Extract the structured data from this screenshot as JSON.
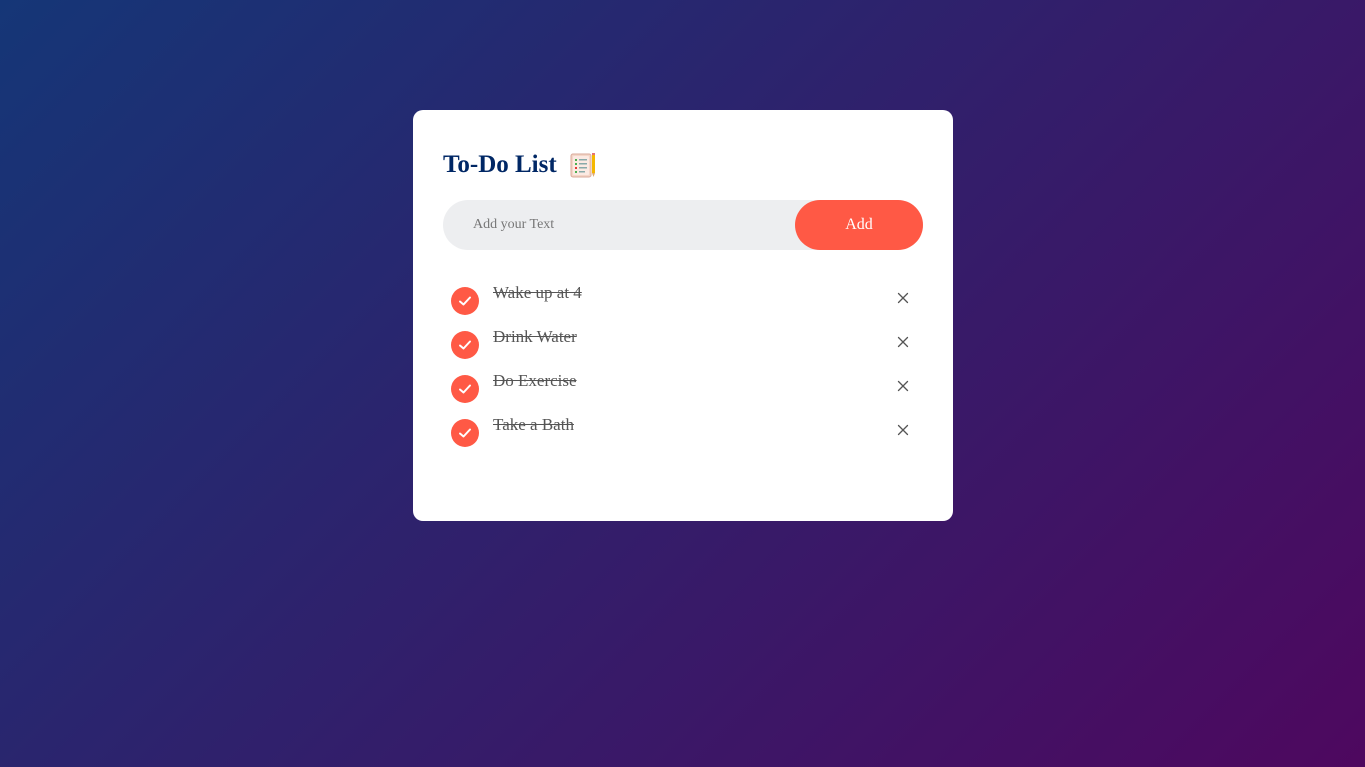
{
  "app": {
    "title": "To-Do List",
    "title_icon": "notebook-with-pencil-icon"
  },
  "input": {
    "value": "",
    "placeholder": "Add your Text"
  },
  "add_button": {
    "label": "Add"
  },
  "tasks": [
    {
      "label": "Wake up at 4",
      "checked": true
    },
    {
      "label": "Drink Water",
      "checked": true
    },
    {
      "label": "Do Exercise",
      "checked": true
    },
    {
      "label": "Take a Bath",
      "checked": true
    }
  ],
  "colors": {
    "accent": "#ff5945",
    "title": "#002765",
    "input_bg": "#edeef0",
    "background_start": "#153677",
    "background_end": "#4e085f"
  }
}
